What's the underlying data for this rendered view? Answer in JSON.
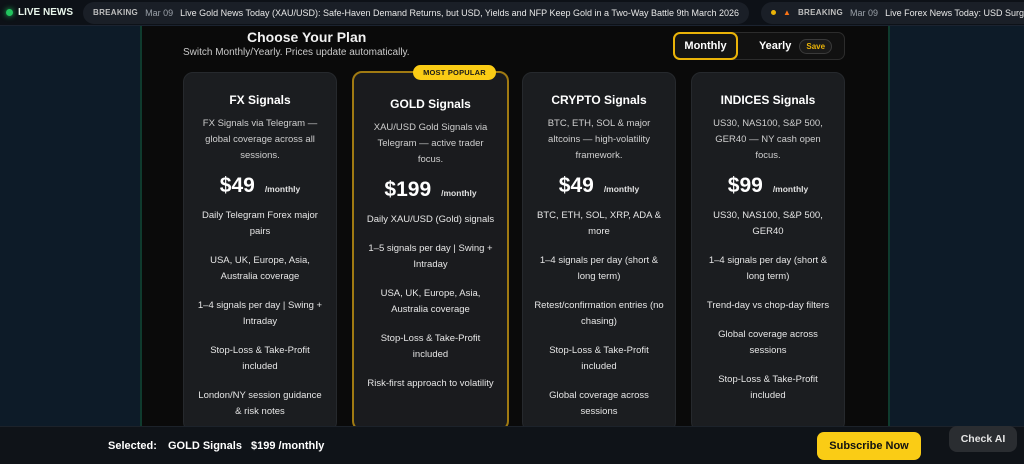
{
  "ticker": {
    "live_label": "LIVE NEWS",
    "items": [
      {
        "tag": "BREAKING",
        "date": "Mar 09",
        "text": "Live Gold News Today (XAU/USD): Safe-Haven Demand Returns, but USD, Yields and NFP Keep Gold in a Two-Way Battle 9th March 2026"
      },
      {
        "tag": "BREAKING",
        "date": "Mar 09",
        "text": "Live Forex News Today: USD Surges on Oil Shock, Inflation Fears Ri"
      }
    ]
  },
  "header": {
    "title": "Choose Your Plan",
    "subtitle": "Switch Monthly/Yearly. Prices update automatically."
  },
  "billing": {
    "monthly_label": "Monthly",
    "yearly_label": "Yearly",
    "save_label": "Save",
    "selected": "Monthly"
  },
  "popular_badge": "MOST POPULAR",
  "plans": [
    {
      "name": "FX Signals",
      "desc": "FX Signals via Telegram — global coverage across all sessions.",
      "price": "$49",
      "period": "/monthly",
      "features": [
        "Daily Telegram Forex major pairs",
        "USA, UK, Europe, Asia, Australia coverage",
        "1–4 signals per day | Swing + Intraday",
        "Stop-Loss & Take-Profit included",
        "London/NY session guidance & risk notes"
      ]
    },
    {
      "name": "GOLD Signals",
      "desc": "XAU/USD Gold Signals via Telegram — active trader focus.",
      "price": "$199",
      "period": "/monthly",
      "features": [
        "Daily XAU/USD (Gold) signals",
        "1–5 signals per day | Swing + Intraday",
        "USA, UK, Europe, Asia, Australia coverage",
        "Stop-Loss & Take-Profit included",
        "Risk-first approach to volatility"
      ]
    },
    {
      "name": "CRYPTO Signals",
      "desc": "BTC, ETH, SOL & major altcoins — high-volatility framework.",
      "price": "$49",
      "period": "/monthly",
      "features": [
        "BTC, ETH, SOL, XRP, ADA & more",
        "1–4 signals per day (short & long term)",
        "Retest/confirmation entries (no chasing)",
        "Stop-Loss & Take-Profit included",
        "Global coverage across sessions"
      ]
    },
    {
      "name": "INDICES Signals",
      "desc": "US30, NAS100, S&P 500, GER40 — NY cash open focus.",
      "price": "$99",
      "period": "/monthly",
      "features": [
        "US30, NAS100, S&P 500, GER40",
        "1–4 signals per day (short & long term)",
        "Trend-day vs chop-day filters",
        "Global coverage across sessions",
        "Stop-Loss & Take-Profit included"
      ]
    }
  ],
  "footer": {
    "selected_label": "Selected:",
    "selected_plan": "GOLD Signals",
    "selected_price": "$199 /monthly",
    "subscribe_label": "Subscribe Now",
    "check_ai_label": "Check AI"
  },
  "colors": {
    "accent": "#facc15",
    "live_dot": "#22c55e",
    "background": "#0a0a0a"
  }
}
